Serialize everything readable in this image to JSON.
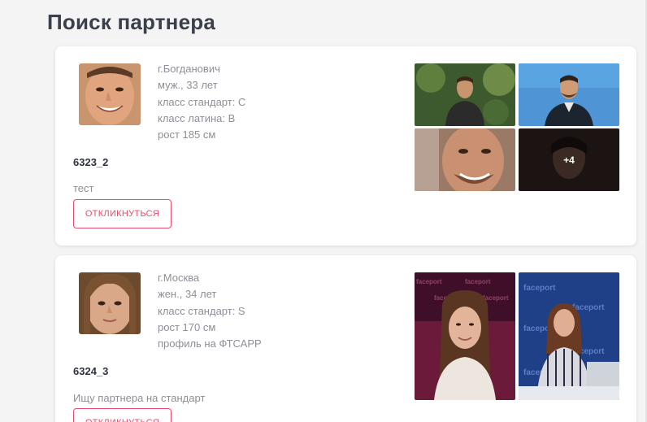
{
  "page": {
    "title": "Поиск партнера"
  },
  "cards": [
    {
      "info": [
        "г.Богданович",
        "муж., 33 лет",
        "класс стандарт: С",
        "класс латина: В",
        "рост 185 см"
      ],
      "id": "6323_2",
      "comment": "тест",
      "button_label": "ОТКЛИКНУТЬСЯ",
      "more_count": "+4"
    },
    {
      "info": [
        "г.Москва",
        "жен., 34 лет",
        "класс стандарт: S",
        "рост 170 см",
        "профиль на ФТСАРР"
      ],
      "id": "6324_3",
      "comment": "Ищу партнера на стандарт",
      "button_label": "ОТКЛИКНУТЬСЯ",
      "photo_watermark": "faceport"
    }
  ],
  "colors": {
    "accent": "#e84c6a",
    "title": "#3a3f4a",
    "muted_text": "#8c8f96",
    "background": "#f4f4f5"
  }
}
